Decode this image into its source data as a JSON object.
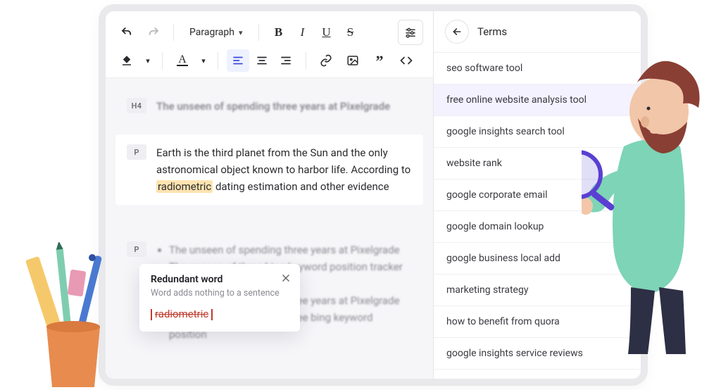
{
  "toolbar": {
    "format_selector": "Paragraph"
  },
  "blocks": {
    "h4": {
      "tag": "H4",
      "text": "The unseen of spending three years at Pixelgrade"
    },
    "p1": {
      "tag": "P",
      "text_before": "Earth is the third planet from the Sun and the only astronomical object known to harbor life. According to ",
      "highlight": "radiometric",
      "text_after": " dating estimation and other evidence"
    },
    "p2": {
      "tag": "P",
      "bullets": [
        "The unseen of spending three years at Pixelgrade",
        "The unseen of three bing keyword position tracker at Pixelgrade",
        "The unseen of spending three years at Pixelgrade",
        "The unseen of spending three bing keyword position"
      ]
    }
  },
  "tooltip": {
    "title": "Redundant word",
    "subtitle": "Word adds nothing to a sentence",
    "word": "radiometric"
  },
  "side": {
    "title": "Terms",
    "terms": [
      "seo software tool",
      "free online website analysis tool",
      "google insights search tool",
      "website rank",
      "google corporate email",
      "google domain lookup",
      "google business local add",
      "marketing strategy",
      "how to benefit from quora",
      "google insights service reviews"
    ],
    "highlight_index": 1
  }
}
